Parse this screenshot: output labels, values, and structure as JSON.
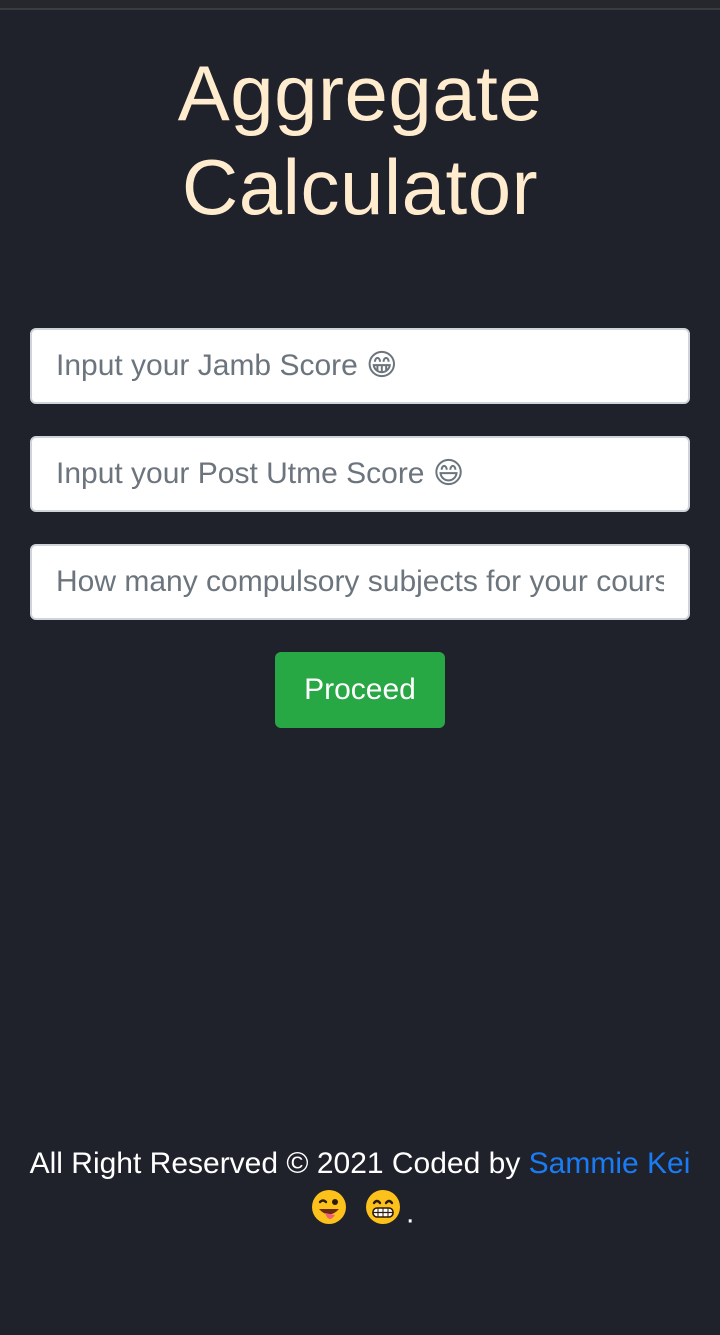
{
  "header": {
    "title": "Aggregate Calculator"
  },
  "form": {
    "jamb_placeholder": "Input your Jamb Score 😁",
    "post_utme_placeholder": "Input your Post Utme Score 😄",
    "subjects_placeholder": "How many compulsory subjects for your course?",
    "proceed_label": "Proceed"
  },
  "footer": {
    "text": "All Right Reserved © 2021 Coded by",
    "author_link": "Sammie Kei",
    "end_punctuation": "."
  },
  "colors": {
    "background": "#1f212b",
    "title": "#ffebce",
    "button": "#28a745",
    "link": "#1a7cf5"
  },
  "icons": [
    "winking-tongue-emoji-icon",
    "grinning-emoji-icon"
  ]
}
